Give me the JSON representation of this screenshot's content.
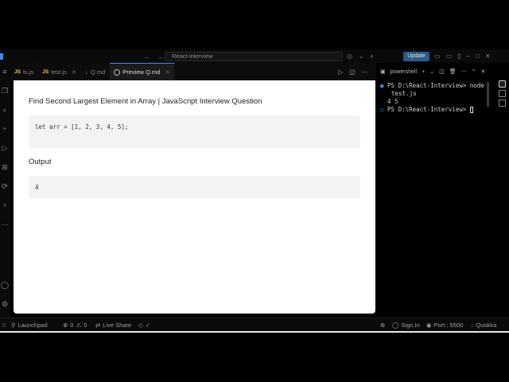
{
  "titlebar": {
    "search_text": "React-interview",
    "update_label": "Update"
  },
  "tabs": [
    {
      "label": "ts.js",
      "type": "js"
    },
    {
      "label": "test.js",
      "type": "js"
    },
    {
      "label": "Q.md",
      "type": "md"
    },
    {
      "label": "Preview Q.md",
      "type": "preview"
    }
  ],
  "preview": {
    "title": "Find Second Largest Element in Array | JavaScript Interview Question",
    "code": "let arr = [1, 2, 3, 4, 5];",
    "output_heading": "Output",
    "output_value": "4"
  },
  "terminal": {
    "shell_name": "powershell",
    "lines": [
      "PS D:\\React-Interview> node",
      "test.js",
      "4 5",
      "PS D:\\React-Interview> "
    ]
  },
  "statusbar": {
    "launchpad": "Launchpad",
    "errors": "0",
    "warnings": "0",
    "live_share": "Live Share",
    "sign_in": "Sign In",
    "port": "Port : 5500",
    "quokka": "Quokka"
  }
}
